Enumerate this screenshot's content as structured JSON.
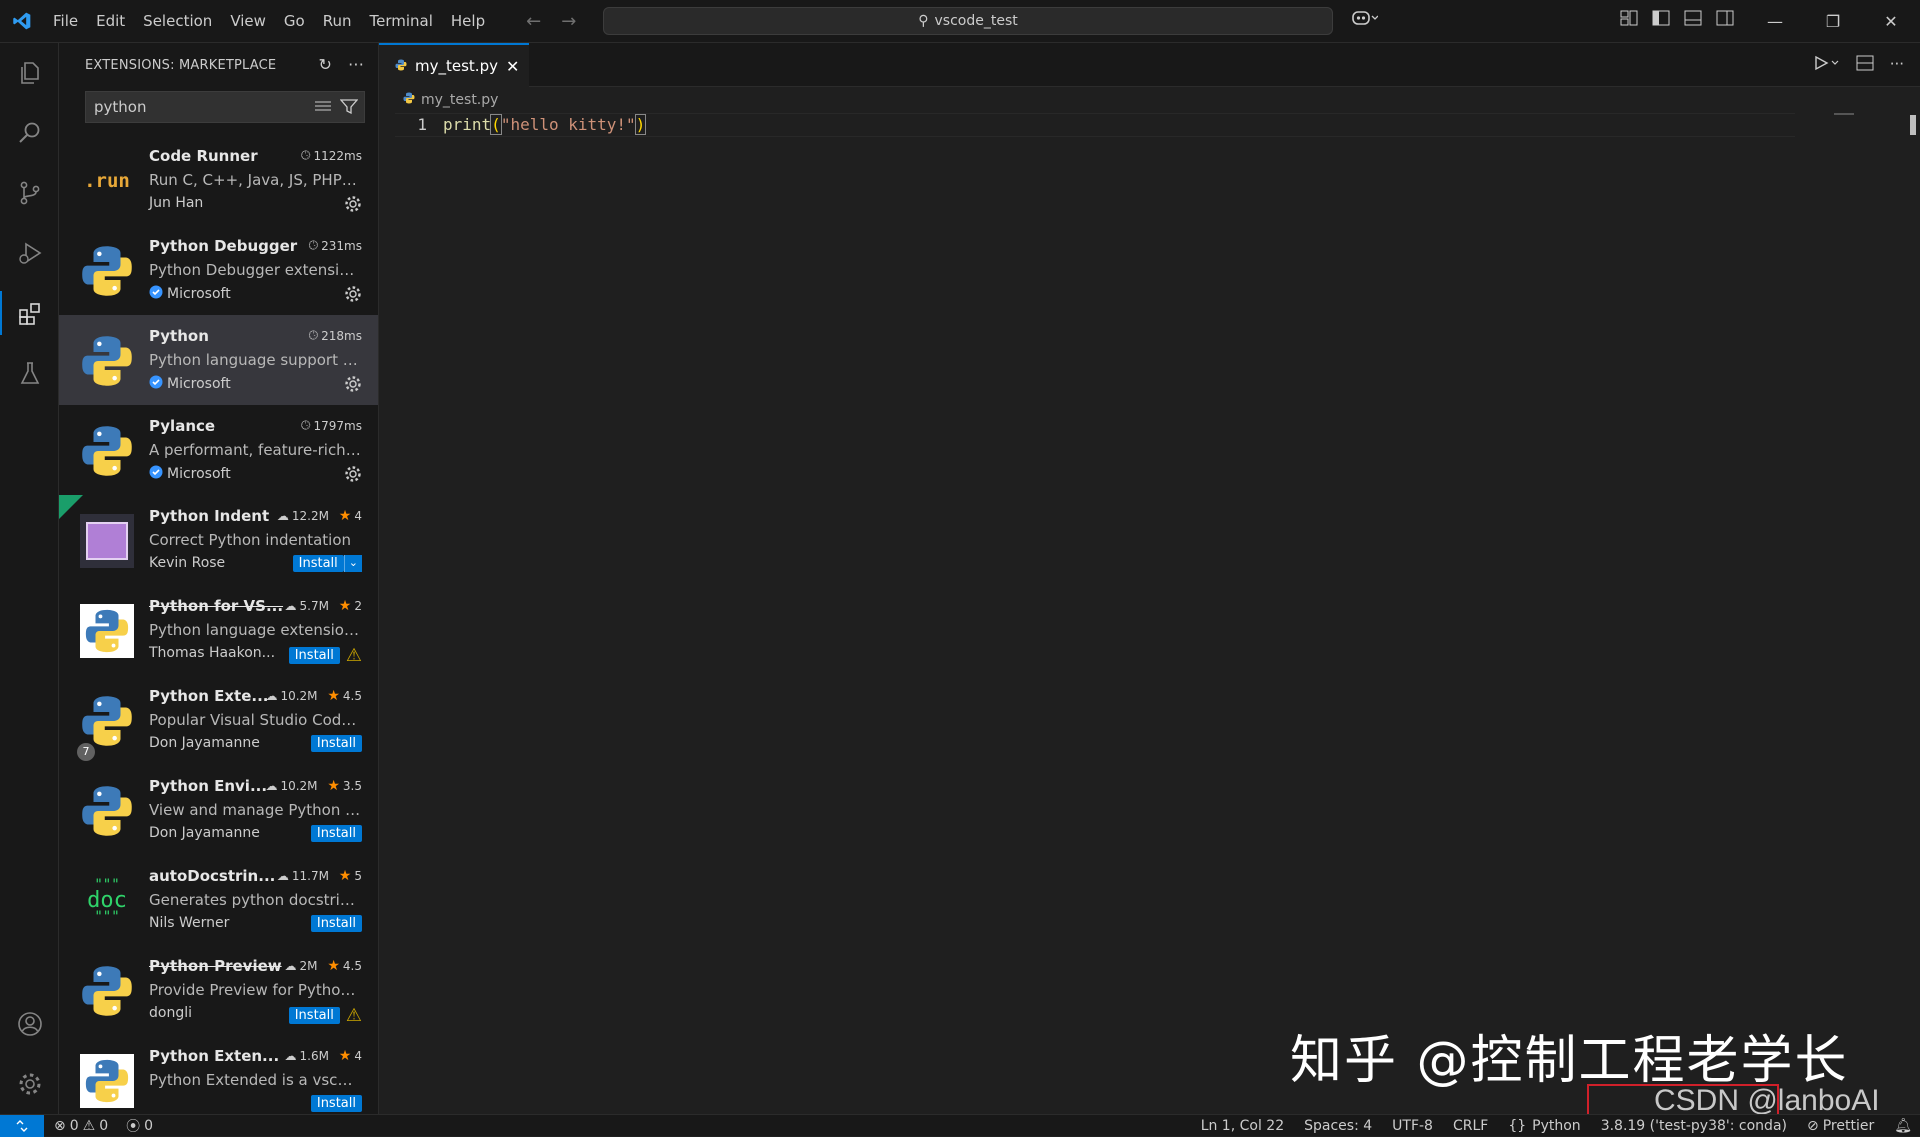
{
  "menu": [
    "File",
    "Edit",
    "Selection",
    "View",
    "Go",
    "Run",
    "Terminal",
    "Help"
  ],
  "command_center": {
    "text": "vscode_test"
  },
  "sidebar": {
    "title": "EXTENSIONS: MARKETPLACE",
    "search_value": "python"
  },
  "extensions": [
    {
      "name": "Code Runner",
      "meta": "1122ms",
      "meta_type": "time",
      "description": "Run C, C++, Java, JS, PHP, P...",
      "publisher": "Jun Han",
      "verified": false,
      "action": "gear",
      "icon": "run"
    },
    {
      "name": "Python Debugger",
      "meta": "231ms",
      "meta_type": "time",
      "description": "Python Debugger extension...",
      "publisher": "Microsoft",
      "verified": true,
      "action": "gear",
      "icon": "python"
    },
    {
      "name": "Python",
      "meta": "218ms",
      "meta_type": "time",
      "description": "Python language support wi...",
      "publisher": "Microsoft",
      "verified": true,
      "action": "gear",
      "icon": "python",
      "selected": true
    },
    {
      "name": "Pylance",
      "meta": "1797ms",
      "meta_type": "time",
      "description": "A performant, feature-rich l...",
      "publisher": "Microsoft",
      "verified": true,
      "action": "gear",
      "icon": "python"
    },
    {
      "name": "Python Indent",
      "meta": "12.2M",
      "meta_type": "downloads",
      "rating": "4",
      "description": "Correct Python indentation",
      "publisher": "Kevin Rose",
      "verified": false,
      "action": "install-split",
      "icon": "indent",
      "ribbon": true
    },
    {
      "name": "Python for VS...",
      "meta": "5.7M",
      "meta_type": "downloads",
      "rating": "2",
      "description": "Python language extension ...",
      "publisher": "Thomas Haakon...",
      "verified": false,
      "action": "install-warn",
      "icon": "python-square",
      "deprecated": true
    },
    {
      "name": "Python Exte...",
      "meta": "10.2M",
      "meta_type": "downloads",
      "rating": "4.5",
      "description": "Popular Visual Studio Code ...",
      "publisher": "Don Jayamanne",
      "verified": false,
      "action": "install",
      "icon": "python",
      "badge": "7"
    },
    {
      "name": "Python Envi...",
      "meta": "10.2M",
      "meta_type": "downloads",
      "rating": "3.5",
      "description": "View and manage Python e...",
      "publisher": "Don Jayamanne",
      "verified": false,
      "action": "install",
      "icon": "python"
    },
    {
      "name": "autoDocstrin...",
      "meta": "11.7M",
      "meta_type": "downloads",
      "rating": "5",
      "description": "Generates python docstring...",
      "publisher": "Nils Werner",
      "verified": false,
      "action": "install",
      "icon": "doc"
    },
    {
      "name": "Python Preview",
      "meta": "2M",
      "meta_type": "downloads",
      "rating": "4.5",
      "description": "Provide Preview for Python ...",
      "publisher": "dongli",
      "verified": false,
      "action": "install-warn",
      "icon": "python",
      "deprecated": true
    },
    {
      "name": "Python Exten...",
      "meta": "1.6M",
      "meta_type": "downloads",
      "rating": "4",
      "description": "Python Extended is a vscod...",
      "publisher": "",
      "verified": false,
      "action": "install",
      "icon": "python-square"
    }
  ],
  "install_label": "Install",
  "editor": {
    "tab_label": "my_test.py",
    "breadcrumb": "my_test.py",
    "line_number": "1",
    "code_fn": "print",
    "code_open": "(",
    "code_str": "\"hello kitty!\"",
    "code_close": ")"
  },
  "watermark": {
    "zhihu": "知乎 @控制工程老学长",
    "csdn": "CSDN @lanboAI"
  },
  "statusbar": {
    "errors": "0",
    "warnings": "0",
    "ports": "0",
    "position": "Ln 1, Col 22",
    "spaces": "Spaces: 4",
    "encoding": "UTF-8",
    "eol": "CRLF",
    "language": "Python",
    "interpreter": "3.8.19 ('test-py38': conda)",
    "prettier": "Prettier"
  },
  "colors": {
    "accent": "#0078d4",
    "bg": "#1f1f1f",
    "sidebar": "#181818",
    "star": "#ff8e00"
  }
}
